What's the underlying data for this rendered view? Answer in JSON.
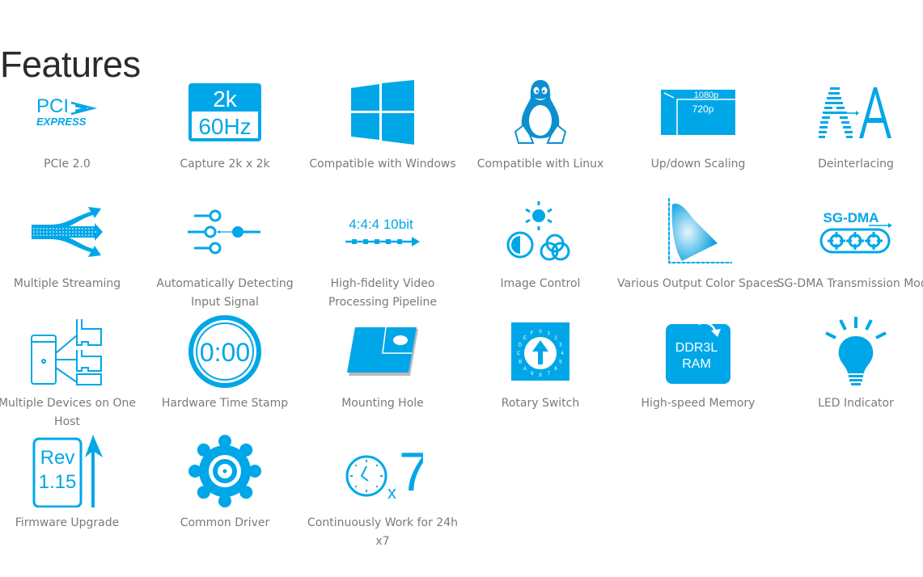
{
  "page": {
    "title": "Features",
    "accent_color": "#00a7e8"
  },
  "features": [
    {
      "label": "PCIe 2.0",
      "icon": "pci-express-icon",
      "icon_text": [
        "PCI",
        "EXPRESS"
      ]
    },
    {
      "label": "Capture 2k x 2k",
      "icon": "resolution-2k-60hz-icon",
      "icon_text": [
        "2k",
        "60Hz"
      ]
    },
    {
      "label": "Compatible with Windows",
      "icon": "windows-logo-icon"
    },
    {
      "label": "Compatible with Linux",
      "icon": "linux-tux-icon"
    },
    {
      "label": "Up/down Scaling",
      "icon": "scaling-icon",
      "icon_text": [
        "1080p",
        "720p"
      ]
    },
    {
      "label": "Deinterlacing",
      "icon": "deinterlacing-icon"
    },
    {
      "label": "Multiple Streaming",
      "icon": "multiple-streaming-arrows-icon"
    },
    {
      "label": "Automatically Detecting Input Signal",
      "icon": "input-signal-switch-icon"
    },
    {
      "label": "High-fidelity Video Processing Pipeline",
      "icon": "pipeline-icon",
      "icon_text": [
        "4:4:4 10bit"
      ]
    },
    {
      "label": "Image Control",
      "icon": "image-control-icon"
    },
    {
      "label": "Various Output Color Spaces",
      "icon": "color-space-gamut-icon"
    },
    {
      "label": "SG-DMA Transmission Mode",
      "icon": "sg-dma-gears-icon",
      "icon_text": [
        "SG-DMA"
      ]
    },
    {
      "label": "Multiple Devices on One Host",
      "icon": "multiple-devices-host-icon"
    },
    {
      "label": "Hardware Time Stamp",
      "icon": "time-stamp-clock-icon",
      "icon_text": [
        "0:00"
      ]
    },
    {
      "label": "Mounting Hole",
      "icon": "mounting-hole-icon"
    },
    {
      "label": "Rotary Switch",
      "icon": "rotary-switch-icon",
      "icon_text": [
        "0123456789ABCDEF"
      ]
    },
    {
      "label": "High-speed Memory",
      "icon": "ddr3l-ram-icon",
      "icon_text": [
        "DDR3L",
        "RAM"
      ]
    },
    {
      "label": "LED Indicator",
      "icon": "led-bulb-icon"
    },
    {
      "label": "Firmware Upgrade",
      "icon": "firmware-upgrade-icon",
      "icon_text": [
        "Rev",
        "1.15"
      ]
    },
    {
      "label": "Common Driver",
      "icon": "gear-icon"
    },
    {
      "label": "Continuously Work for 24h x7",
      "icon": "clock-24x7-icon",
      "icon_text": [
        "x",
        "7"
      ]
    }
  ]
}
